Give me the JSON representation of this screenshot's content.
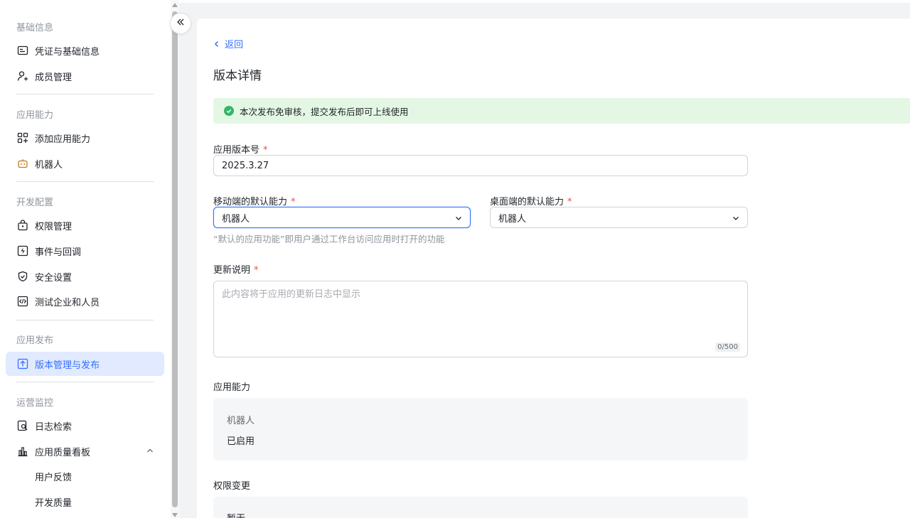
{
  "sidebar": {
    "groups": [
      {
        "title": "基础信息"
      },
      {
        "title": "应用能力"
      },
      {
        "title": "开发配置"
      },
      {
        "title": "应用发布"
      },
      {
        "title": "运营监控"
      }
    ],
    "items": [
      {
        "label": "凭证与基础信息",
        "icon": "credential-card-icon"
      },
      {
        "label": "成员管理",
        "icon": "add-member-icon"
      },
      {
        "label": "添加应用能力",
        "icon": "add-capability-icon"
      },
      {
        "label": "机器人",
        "icon": "robot-icon"
      },
      {
        "label": "权限管理",
        "icon": "permission-lock-icon"
      },
      {
        "label": "事件与回调",
        "icon": "event-icon"
      },
      {
        "label": "安全设置",
        "icon": "shield-icon"
      },
      {
        "label": "测试企业和人员",
        "icon": "code-icon"
      },
      {
        "label": "版本管理与发布",
        "icon": "upload-icon",
        "active": true
      },
      {
        "label": "日志检索",
        "icon": "log-search-icon"
      },
      {
        "label": "应用质量看板",
        "icon": "bar-chart-icon",
        "expanded": true
      },
      {
        "label": "用户反馈"
      },
      {
        "label": "开发质量"
      }
    ]
  },
  "main": {
    "back_label": "返回",
    "page_title": "版本详情",
    "alert_text": "本次发布免审核，提交发布后即可上线使用",
    "version_label": "应用版本号",
    "version_value": "2025.3.27",
    "mobile_label": "移动端的默认能力",
    "mobile_value": "机器人",
    "desktop_label": "桌面端的默认能力",
    "desktop_value": "机器人",
    "hint_text": "“默认的应用功能”即用户通过工作台访问应用时打开的功能",
    "notes_label": "更新说明",
    "notes_placeholder": "此内容将于应用的更新日志中显示",
    "notes_counter": "0/500",
    "capability_title": "应用能力",
    "capability_name": "机器人",
    "capability_status": "已启用",
    "permission_title": "权限变更",
    "permission_value": "暂无",
    "required_mark": "*"
  },
  "colors": {
    "accent": "#3370ff",
    "success": "#34b56b",
    "required": "#f54a45"
  }
}
